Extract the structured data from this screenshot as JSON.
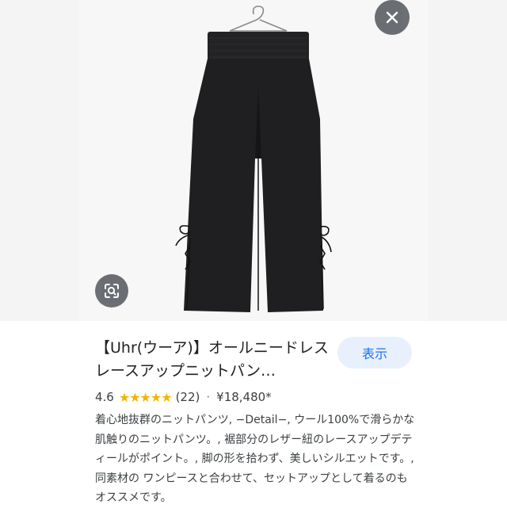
{
  "image": {
    "alt": "",
    "close_icon": "close-icon",
    "lens_icon": "lens-search-icon"
  },
  "product": {
    "title": "【Uhr(ウーア)】オールニードレスレースアップニットパン…",
    "show_label": "表示",
    "rating": "4.6",
    "stars": "★★★★★",
    "review_count": "(22)",
    "separator": "·",
    "price": "¥18,480*",
    "description": "着心地抜群のニットパンツ, −Detail−, ウール100%で滑らかな肌触りのニットパンツ。, 裾部分のレザー紐のレースアップデティールがポイント。, 脚の形を拾わず、美しいシルエットです。, 同素材の ワンピースと合わせて、セットアップとして着るのもオススメです。"
  },
  "colors": {
    "accent": "#1a73e8",
    "accent_bg": "#e8f0fe",
    "star": "#f4b400",
    "garment": "#1f1f21"
  }
}
